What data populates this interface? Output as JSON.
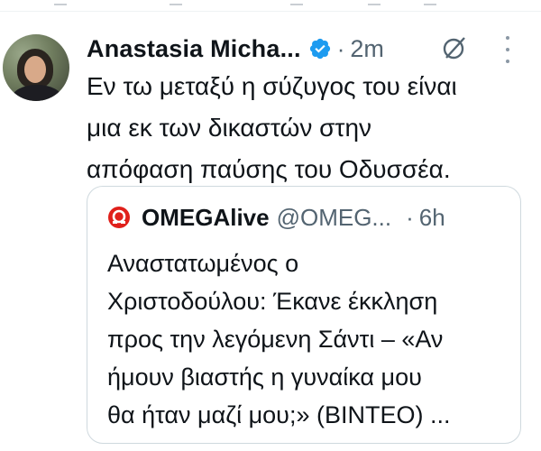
{
  "tweet": {
    "author_name": "Anastasia Micha...",
    "time": "2m",
    "separator": "·",
    "text_lines": [
      "Εν τω μεταξύ η σύζυγος του είναι",
      "μια εκ των δικαστών στην",
      "απόφαση παύσης του Οδυσσέα."
    ]
  },
  "quote": {
    "author_name": "OMEGAlive",
    "handle": "@OMEG...",
    "separator": "·",
    "time": "6h",
    "text_lines": [
      "Αναστατωμένος ο",
      "Χριστοδούλου: Έκανε έκκληση",
      "προς την λεγόμενη Σάντι – «Αν",
      "ήμουν βιαστής η γυναίκα μου",
      "θα ήταν μαζί μου;» (ΒΙΝΤΕΟ) ..."
    ]
  },
  "icons": {
    "verified": "verified-badge-icon",
    "grok": "grok-icon",
    "more": "more-options-icon",
    "omega": "omega-logo-icon",
    "avatar": "avatar"
  },
  "colors": {
    "verified_blue": "#1d9bf0",
    "secondary_text": "#536471",
    "omega_red": "#e0201b"
  }
}
